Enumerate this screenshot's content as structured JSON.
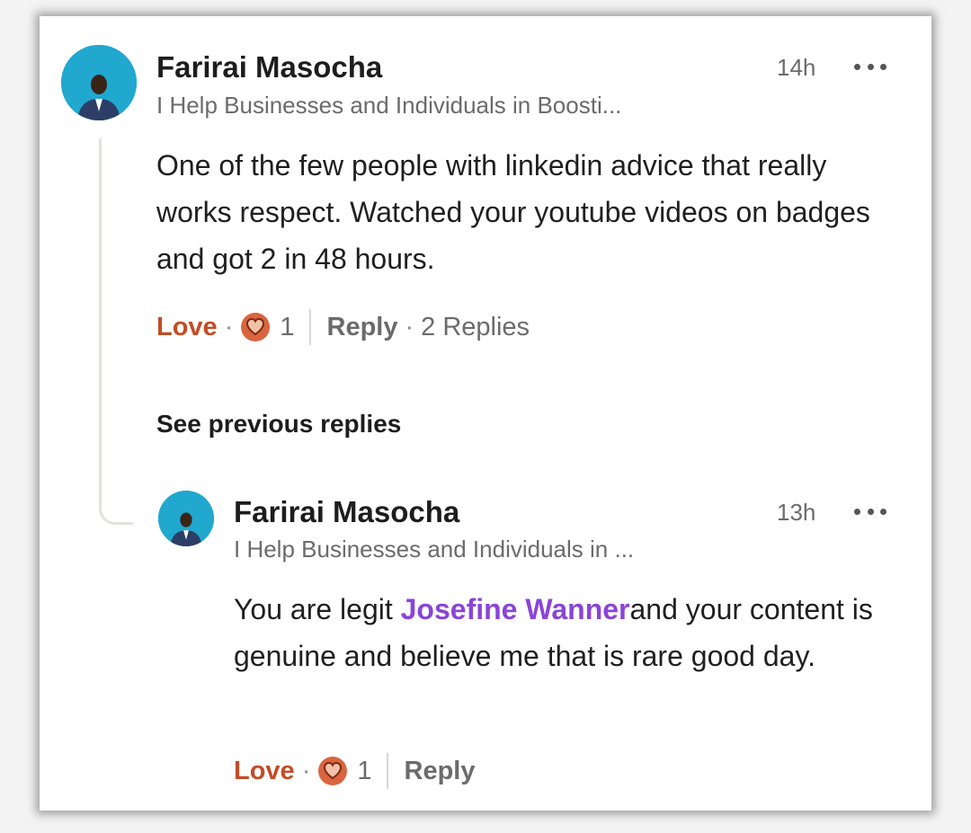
{
  "comment": {
    "author": "Farirai Masocha",
    "headline": "I Help Businesses and Individuals in Boosti...",
    "time": "14h",
    "text": "One of the few people with linkedin advice that really works respect. Watched your youtube videos on badges and got 2 in 48 hours.",
    "reaction_label": "Love",
    "reaction_count": "1",
    "reply_label": "Reply",
    "replies_label": "2 Replies"
  },
  "see_previous_label": "See previous replies",
  "reply_comment": {
    "author": "Farirai Masocha",
    "headline": "I Help Businesses and Individuals in ...",
    "time": "13h",
    "text_before": "You are legit ",
    "mention": "Josefine Wanner",
    "text_after": "and your content is genuine and believe me that is rare good day.",
    "reaction_label": "Love",
    "reaction_count": "1",
    "reply_label": "Reply"
  },
  "colors": {
    "love": "#c14d27",
    "mention": "#8a44d6",
    "avatar_bg": "#20a8cf"
  },
  "icons": [
    "more-options-icon",
    "heart-reaction-icon",
    "avatar-image"
  ]
}
